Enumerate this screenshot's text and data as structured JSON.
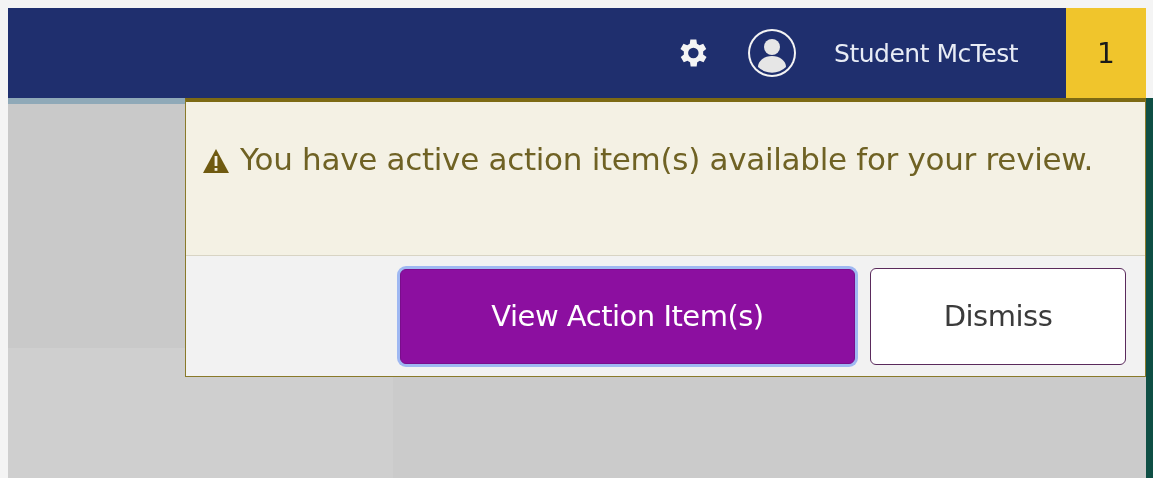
{
  "navbar": {
    "user_name": "Student McTest",
    "notification_count": "1"
  },
  "alert": {
    "message": "You have active action item(s) available for your review.",
    "buttons": [
      {
        "label": "View Action Item(s)",
        "kind": "primary",
        "focused": true
      },
      {
        "label": "Dismiss",
        "kind": "secondary",
        "focused": false
      }
    ]
  }
}
